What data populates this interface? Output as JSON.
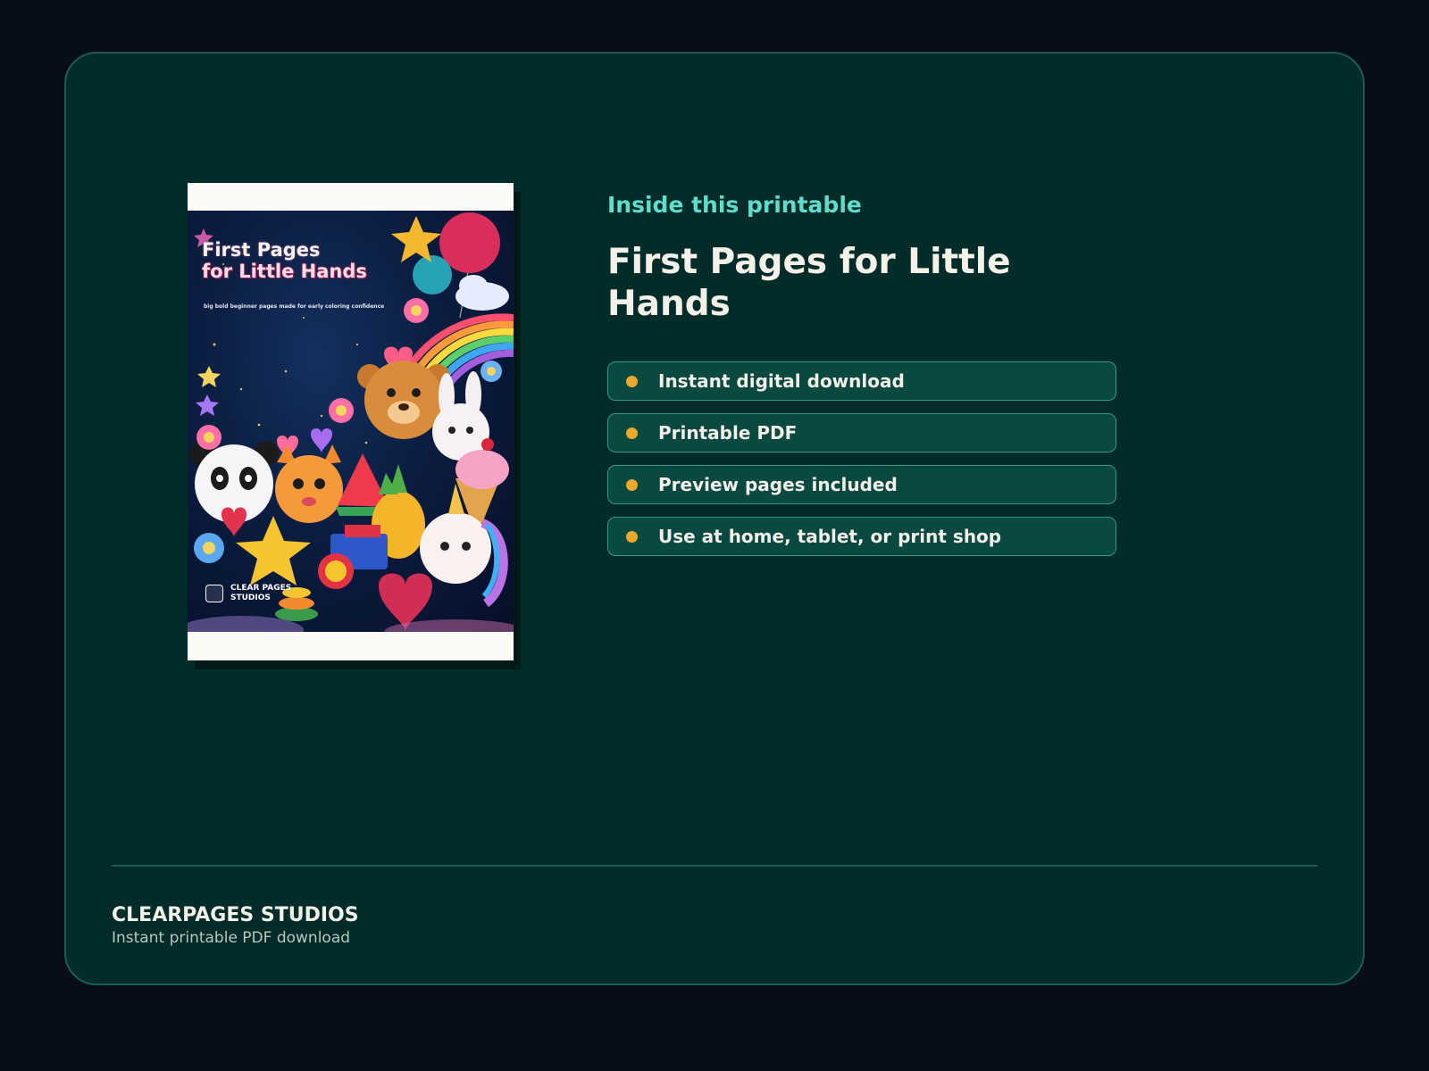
{
  "cover": {
    "title_line1": "First Pages",
    "title_line2": "for Little Hands",
    "subtitle": "big bold beginner pages made for early coloring confidence",
    "brand": "CLEAR PAGES STUDIOS"
  },
  "product": {
    "eyebrow": "Inside this printable",
    "title": "First Pages for Little Hands",
    "features": [
      "Instant digital download",
      "Printable PDF",
      "Preview pages included",
      "Use at home, tablet, or print shop"
    ]
  },
  "footer": {
    "brand": "CLEARPAGES STUDIOS",
    "tagline": "Instant printable PDF download"
  },
  "colors": {
    "page_background": "#080e19",
    "card_background": "#022c2a",
    "accent_teal": "#5fdccc",
    "bullet_gold": "#e8a92c",
    "feature_fill": "#094940"
  }
}
